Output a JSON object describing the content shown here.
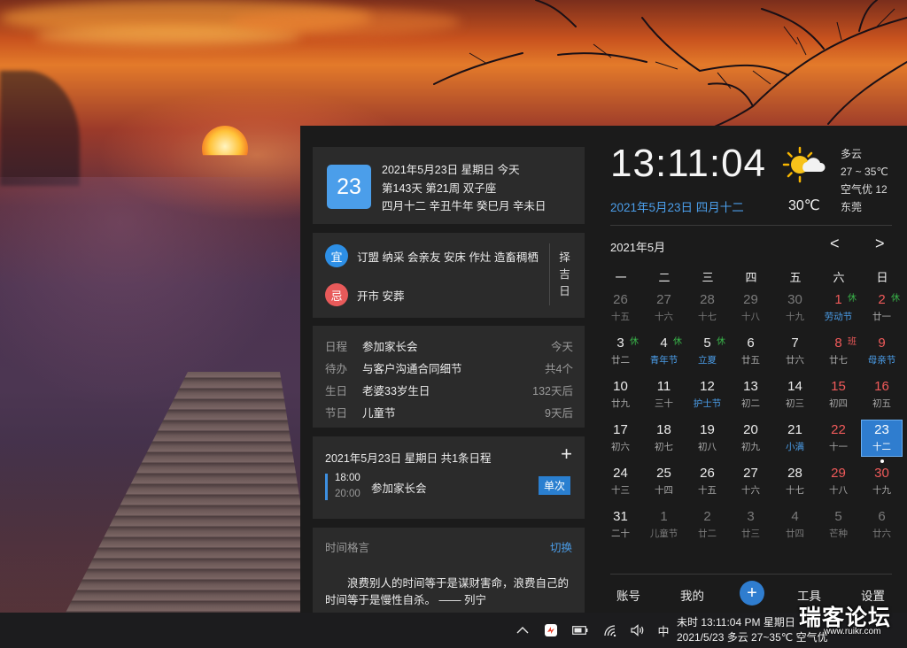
{
  "date_card": {
    "day": "23",
    "line1": "2021年5月23日 星期日 今天",
    "line2": "第143天 第21周 双子座",
    "line3": "四月十二 辛丑牛年 癸巳月 辛未日"
  },
  "almanac": {
    "yi_badge": "宜",
    "yi_text": "订盟 纳采 会亲友 安床 作灶 造畜稠栖",
    "ji_badge": "忌",
    "ji_text": "开市 安葬",
    "zeji": [
      "择",
      "吉",
      "日"
    ],
    "colors": {
      "yi": "#2d8fe6",
      "ji": "#e85a5a"
    }
  },
  "events": [
    {
      "category": "日程",
      "title": "参加家长会",
      "when": "今天"
    },
    {
      "category": "待办",
      "title": "与客户沟通合同细节",
      "when": "共4个"
    },
    {
      "category": "生日",
      "title": "老婆33岁生日",
      "when": "132天后"
    },
    {
      "category": "节日",
      "title": "儿童节",
      "when": "9天后"
    }
  ],
  "schedule": {
    "header": "2021年5月23日 星期日 共1条日程",
    "add": "+",
    "start": "18:00",
    "end": "20:00",
    "title": "参加家长会",
    "tag": "单次"
  },
  "quote": {
    "header": "时间格言",
    "switch": "切换",
    "text": "浪费别人的时间等于是谋财害命，浪费自己的时间等于是慢性自杀。 —— 列宁"
  },
  "clock": {
    "time": "13:11:04",
    "date": "2021年5月23日 四月十二"
  },
  "weather": {
    "temp": "30℃",
    "condition": "多云",
    "range": "27 ~ 35℃",
    "air": "空气优 12",
    "city": "东莞",
    "icon": "sun-cloud-icon"
  },
  "calendar": {
    "month_label": "2021年5月",
    "prev": "<",
    "next": ">",
    "weekdays": [
      "一",
      "二",
      "三",
      "四",
      "五",
      "六",
      "日"
    ],
    "colors": {
      "normal": "#ededed",
      "dim": "#7a7a7a",
      "red": "#f05a5a",
      "blue": "#4b9eea",
      "green": "#39b54a",
      "sub": "#a8a8a8"
    },
    "weeks": [
      [
        {
          "n": "26",
          "s": "十五",
          "dim": true
        },
        {
          "n": "27",
          "s": "十六",
          "dim": true
        },
        {
          "n": "28",
          "s": "十七",
          "dim": true
        },
        {
          "n": "29",
          "s": "十八",
          "dim": true
        },
        {
          "n": "30",
          "s": "十九",
          "dim": true
        },
        {
          "n": "1",
          "s": "劳动节",
          "red": true,
          "mark": "休",
          "mark_color": "green",
          "sub_color": "blue"
        },
        {
          "n": "2",
          "s": "廿一",
          "red": true,
          "mark": "休",
          "mark_color": "green"
        }
      ],
      [
        {
          "n": "3",
          "s": "廿二",
          "mark": "休",
          "mark_color": "green"
        },
        {
          "n": "4",
          "s": "青年节",
          "mark": "休",
          "mark_color": "green",
          "sub_color": "blue"
        },
        {
          "n": "5",
          "s": "立夏",
          "mark": "休",
          "mark_color": "green",
          "sub_color": "blue"
        },
        {
          "n": "6",
          "s": "廿五"
        },
        {
          "n": "7",
          "s": "廿六"
        },
        {
          "n": "8",
          "s": "廿七",
          "red": true,
          "mark": "班",
          "mark_color": "red"
        },
        {
          "n": "9",
          "s": "母亲节",
          "red": true,
          "sub_color": "blue"
        }
      ],
      [
        {
          "n": "10",
          "s": "廿九"
        },
        {
          "n": "11",
          "s": "三十"
        },
        {
          "n": "12",
          "s": "护士节",
          "sub_color": "blue"
        },
        {
          "n": "13",
          "s": "初二"
        },
        {
          "n": "14",
          "s": "初三"
        },
        {
          "n": "15",
          "s": "初四",
          "red": true
        },
        {
          "n": "16",
          "s": "初五",
          "red": true
        }
      ],
      [
        {
          "n": "17",
          "s": "初六"
        },
        {
          "n": "18",
          "s": "初七"
        },
        {
          "n": "19",
          "s": "初八"
        },
        {
          "n": "20",
          "s": "初九"
        },
        {
          "n": "21",
          "s": "小满",
          "sub_color": "blue"
        },
        {
          "n": "22",
          "s": "十一",
          "red": true
        },
        {
          "n": "23",
          "s": "十二",
          "selected": true,
          "dot": true
        }
      ],
      [
        {
          "n": "24",
          "s": "十三"
        },
        {
          "n": "25",
          "s": "十四"
        },
        {
          "n": "26",
          "s": "十五"
        },
        {
          "n": "27",
          "s": "十六"
        },
        {
          "n": "28",
          "s": "十七"
        },
        {
          "n": "29",
          "s": "十八",
          "red": true
        },
        {
          "n": "30",
          "s": "十九",
          "red": true
        }
      ],
      [
        {
          "n": "31",
          "s": "二十"
        },
        {
          "n": "1",
          "s": "儿童节",
          "dim": true
        },
        {
          "n": "2",
          "s": "廿二",
          "dim": true
        },
        {
          "n": "3",
          "s": "廿三",
          "dim": true
        },
        {
          "n": "4",
          "s": "廿四",
          "dim": true
        },
        {
          "n": "5",
          "s": "芒种",
          "dim": true
        },
        {
          "n": "6",
          "s": "廿六",
          "dim": true
        }
      ]
    ]
  },
  "bottom_nav": {
    "account": "账号",
    "mine": "我的",
    "add": "+",
    "tools": "工具",
    "settings": "设置"
  },
  "taskbar": {
    "ime": "中",
    "clock_line1": "未时 13:11:04 PM 星期日",
    "clock_line2": "2021/5/23 多云 27~35℃ 空气优"
  },
  "watermark": {
    "text": "瑞客论坛",
    "url": "www.ruikr.com"
  }
}
